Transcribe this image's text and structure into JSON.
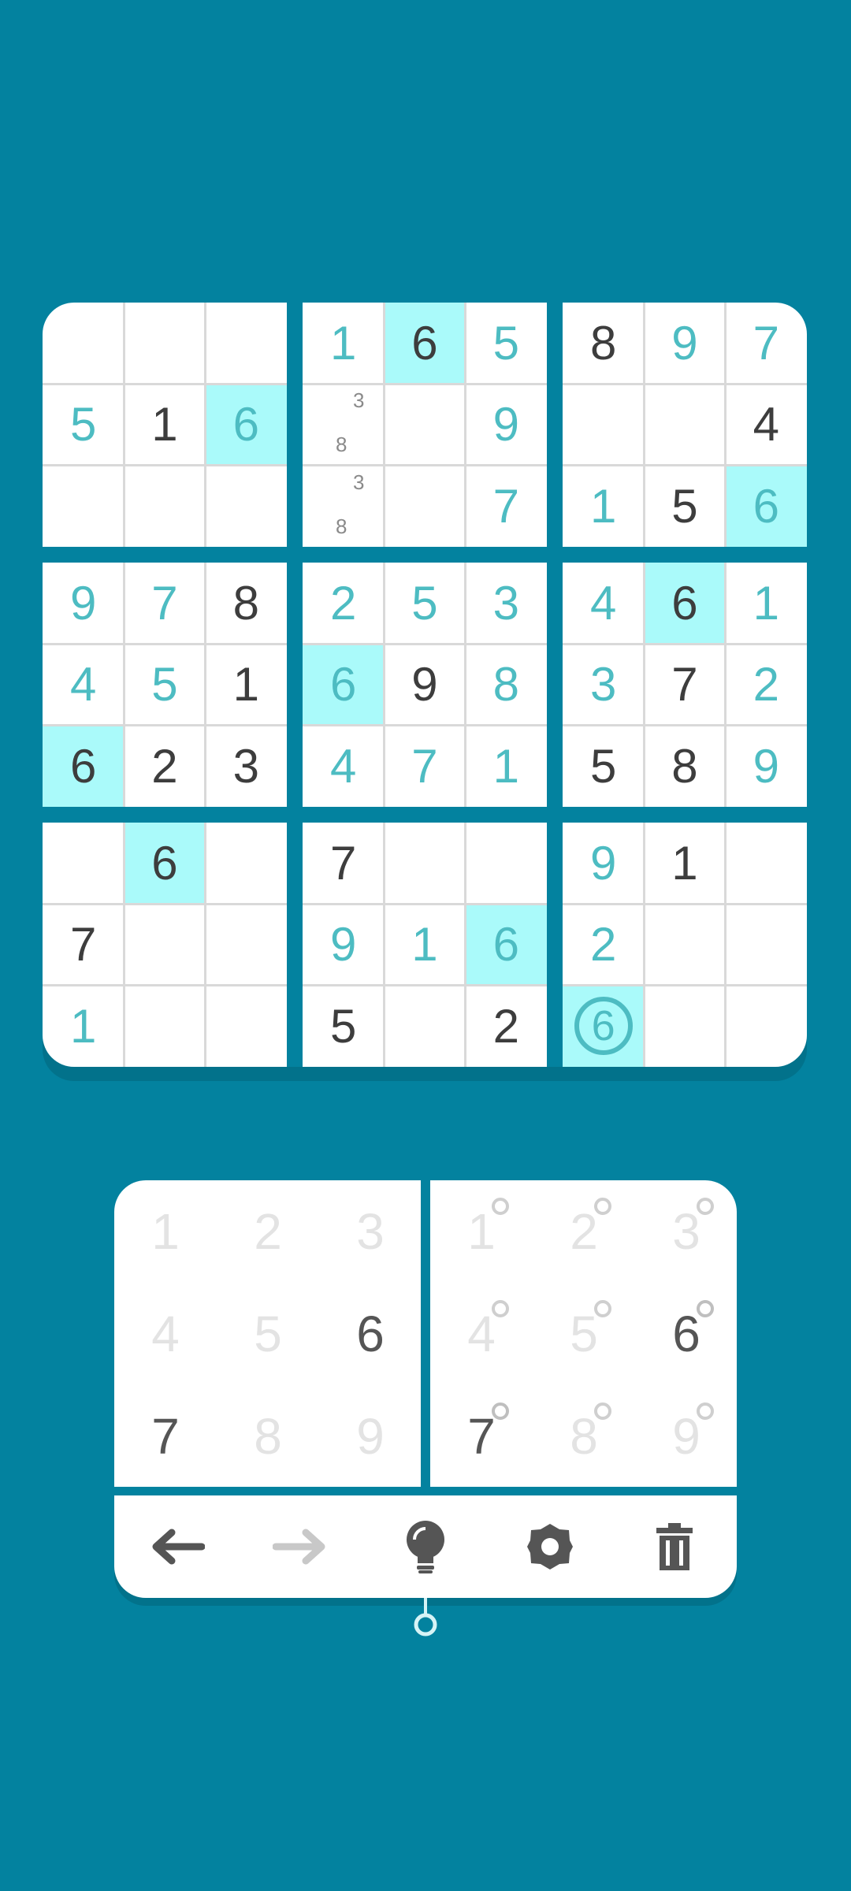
{
  "board": {
    "rows": [
      [
        "",
        "",
        "",
        "1",
        "6",
        "5",
        "8",
        "9",
        "7"
      ],
      [
        "5",
        "1",
        "6",
        "",
        "",
        "9",
        "",
        "",
        "4"
      ],
      [
        "",
        "",
        "",
        "",
        "",
        "7",
        "1",
        "5",
        "6"
      ],
      [
        "9",
        "7",
        "8",
        "2",
        "5",
        "3",
        "4",
        "6",
        "1"
      ],
      [
        "4",
        "5",
        "1",
        "6",
        "9",
        "8",
        "3",
        "7",
        "2"
      ],
      [
        "6",
        "2",
        "3",
        "4",
        "7",
        "1",
        "5",
        "8",
        "9"
      ],
      [
        "",
        "6",
        "",
        "7",
        "",
        "",
        "9",
        "1",
        ""
      ],
      [
        "7",
        "",
        "",
        "9",
        "1",
        "6",
        "2",
        "",
        ""
      ],
      [
        "1",
        "",
        "",
        "5",
        "",
        "2",
        "6",
        "",
        ""
      ]
    ],
    "given_mask": [
      "000010100",
      "010000001",
      "000000010",
      "001000010",
      "001010010",
      "111000110",
      "010100010",
      "100000000",
      "000101000"
    ],
    "highlighted_mask": [
      "000010000",
      "001000000",
      "000000001",
      "000000010",
      "000100000",
      "100000000",
      "010000000",
      "000001000",
      "000000100"
    ],
    "selected_cell": "r8c6",
    "notes": {
      "r1c3": [
        "3",
        "8"
      ],
      "r2c3": [
        "3",
        "8"
      ]
    }
  },
  "pad": {
    "value_keys": [
      "1",
      "2",
      "3",
      "4",
      "5",
      "6",
      "7",
      "8",
      "9"
    ],
    "note_keys": [
      "1",
      "2",
      "3",
      "4",
      "5",
      "6",
      "7",
      "8",
      "9"
    ],
    "active_keys": [
      "6",
      "7"
    ]
  },
  "toolbar": {
    "undo_icon": "arrow-left-icon",
    "redo_icon": "arrow-right-icon",
    "hint_icon": "lightbulb-icon",
    "settings_icon": "gear-icon",
    "delete_icon": "trash-icon",
    "redo_enabled": false
  },
  "colors": {
    "background": "#03829f",
    "given_digit": "#3d3d3d",
    "entered_digit": "#4dbcc2",
    "highlight": "#aafafa",
    "disabled": "#c8c8c8"
  }
}
